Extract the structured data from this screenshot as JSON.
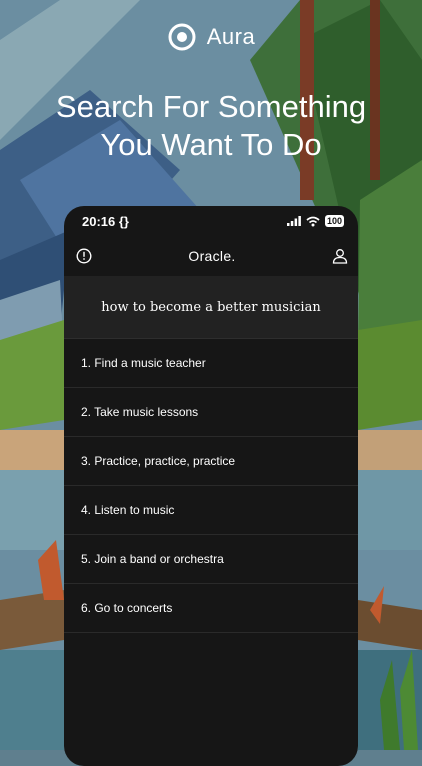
{
  "app": {
    "brand_name": "Aura"
  },
  "headline": {
    "line1": "Search For Something",
    "line2": "You Want To Do"
  },
  "phone": {
    "status_bar": {
      "time": "20:16",
      "time_suffix": "{}",
      "battery": "100"
    },
    "app_bar": {
      "title": "Oracle.",
      "left_icon": "info-circle-icon",
      "right_icon": "user-icon"
    },
    "query": "how to become a better musician",
    "results": [
      {
        "label": "1. Find a music teacher"
      },
      {
        "label": "2. Take music lessons"
      },
      {
        "label": "3. Practice, practice, practice"
      },
      {
        "label": "4. Listen to music"
      },
      {
        "label": "5. Join a band or orchestra"
      },
      {
        "label": "6. Go to concerts"
      }
    ]
  },
  "colors": {
    "phone_bg": "#161616",
    "query_bg": "#222222",
    "text": "#ffffff"
  }
}
